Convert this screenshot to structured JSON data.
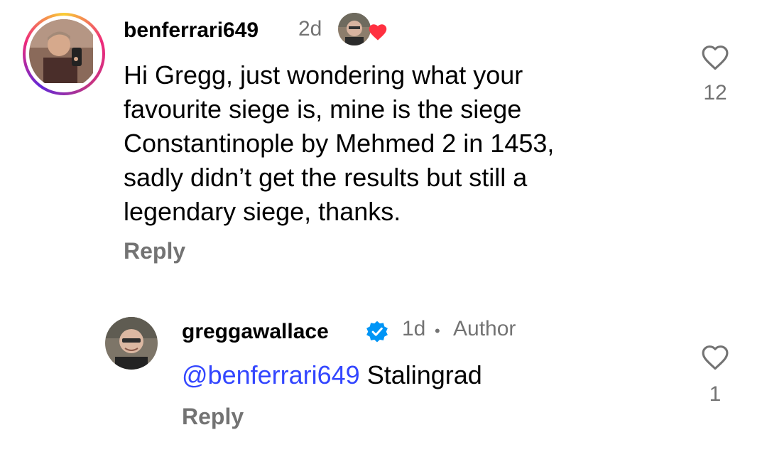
{
  "comments": [
    {
      "username": "benferrari649",
      "time": "2d",
      "liked_by_author": true,
      "text": "Hi Gregg, just wondering what your favourite siege is, mine is the siege Constantinople by Mehmed 2 in 1453, sadly didn’t get the results but still a legendary siege, thanks.",
      "text_lines": [
        "Hi Gregg, just wondering what your",
        "favourite siege is, mine is the siege",
        "Constantinople by Mehmed 2 in 1453,",
        "sadly didn’t get the results but still a",
        "legendary siege, thanks."
      ],
      "reply_label": "Reply",
      "likes": "12",
      "has_story_ring": true
    },
    {
      "username": "greggawallace",
      "verified": true,
      "time": "1d",
      "separator": "•",
      "role": "Author",
      "mention": "@benferrari649",
      "text": "Stalingrad",
      "reply_label": "Reply",
      "likes": "1"
    }
  ],
  "icons": {
    "like": "heart-outline-icon",
    "verified": "verified-badge-icon",
    "author_like": "red-heart-icon"
  },
  "colors": {
    "mention": "#3346ff",
    "secondary_text": "#737373",
    "verified_blue": "#0095f6",
    "heart_red": "#ff3040"
  }
}
